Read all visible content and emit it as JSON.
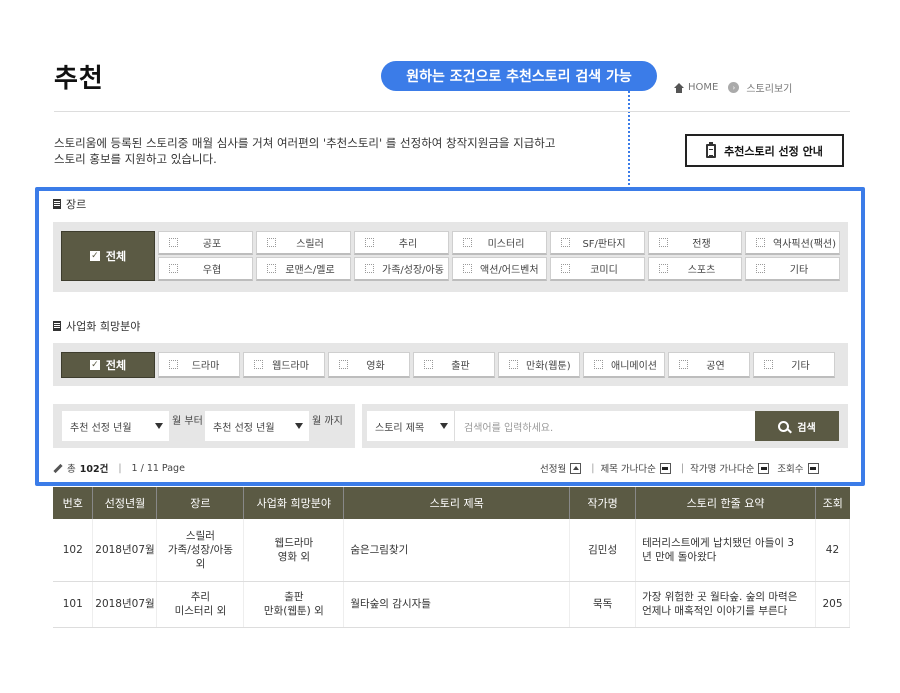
{
  "header": {
    "title": "추천",
    "callout": "원하는 조건으로 추천스토리 검색 가능",
    "breadcrumb": {
      "home": "HOME",
      "current": "스토리보기"
    }
  },
  "intro": {
    "line1": "스토리움에 등록된 스토리중 매월 심사를 거쳐 여러편의 '추천스토리' 를 선정하여 창작지원금을 지급하고",
    "line2": "스토리 홍보를 지원하고 있습니다."
  },
  "guide_button": {
    "label": "추천스토리 선정 안내",
    "icon": "clipboard-icon"
  },
  "genre": {
    "label": "장르",
    "all_label": "전체",
    "options": [
      "공포",
      "스릴러",
      "추리",
      "미스터리",
      "SF/판타지",
      "전쟁",
      "역사픽션(팩션)",
      "우협",
      "로맨스/멜로",
      "가족/성장/아동",
      "액션/어드벤처",
      "코미디",
      "스포츠",
      "기타"
    ]
  },
  "business": {
    "label": "사업화 희망분야",
    "all_label": "전체",
    "options": [
      "드라마",
      "웹드라마",
      "영화",
      "출판",
      "만화(웹툰)",
      "애니메이션",
      "공연",
      "기타"
    ]
  },
  "search": {
    "year_from": "추천 선정 년월",
    "from_label": "월 부터",
    "year_to": "추천 선정 년월",
    "to_label": "월 까지",
    "field": "스토리 제목",
    "placeholder": "검색어를 입력하세요.",
    "button": "검색"
  },
  "summary": {
    "total_prefix": "총",
    "total_count": "102건",
    "page": "1 / 11 Page"
  },
  "sort": [
    "선정월",
    "제목 가나다순",
    "작가명 가나다순",
    "조회수"
  ],
  "table": {
    "headers": [
      "번호",
      "선정년월",
      "장르",
      "사업화 희망분야",
      "스토리 제목",
      "작가명",
      "스토리 한줄 요약",
      "조회"
    ],
    "rows": [
      {
        "no": "102",
        "date": "2018년07월",
        "genre": [
          "스릴러",
          "가족/성장/아동",
          "외"
        ],
        "field": [
          "웹드라마",
          "영화 외"
        ],
        "title": "숨은그림찾기",
        "author": "김민성",
        "summary": [
          "테러리스트에게 납치됐던 아들이 3",
          "년 만에 돌아왔다"
        ],
        "views": "42"
      },
      {
        "no": "101",
        "date": "2018년07월",
        "genre": [
          "추리",
          "미스터리 외"
        ],
        "field": [
          "출판",
          "만화(웹툰) 외"
        ],
        "title": "월타숲의 감시자들",
        "author": "묵독",
        "summary": [
          "가장 위험한 곳 월타숲. 숲의 마력은",
          "언제나 매혹적인 이야기를 부른다"
        ],
        "views": "205"
      }
    ]
  },
  "colors": {
    "accent": "#3b7ce8",
    "olive": "#5b5a44",
    "panel": "#e6e6e6"
  }
}
